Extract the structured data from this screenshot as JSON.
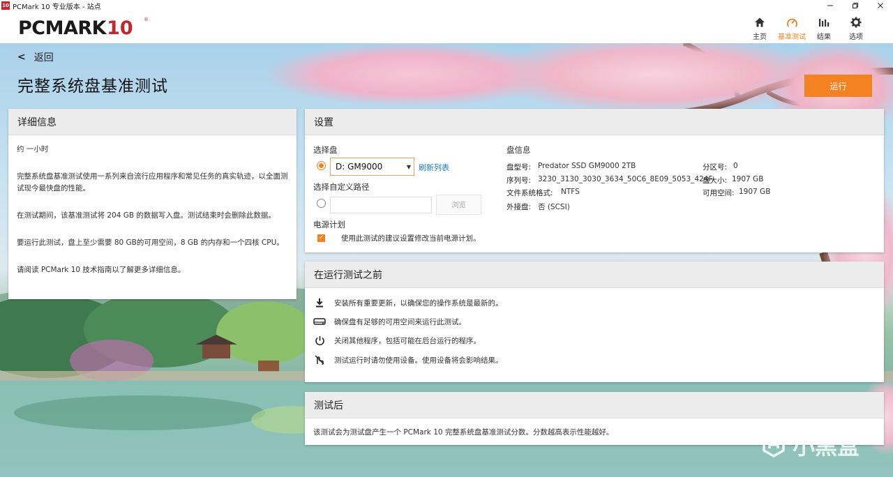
{
  "window": {
    "title": "PCMark 10 专业版本 - 站点",
    "icon_text": "10"
  },
  "header": {
    "logo_main": "PCMARK",
    "logo_num": "10",
    "logo_reg": "®",
    "nav": [
      {
        "label": "主页",
        "icon": "home-icon"
      },
      {
        "label": "基准测试",
        "icon": "gauge-icon",
        "active": true
      },
      {
        "label": "结果",
        "icon": "bar-chart-icon"
      },
      {
        "label": "选项",
        "icon": "gear-icon"
      }
    ]
  },
  "page": {
    "back_label": "返回",
    "title": "完整系统盘基准测试",
    "run_label": "运行"
  },
  "details": {
    "header": "详细信息",
    "paragraphs": [
      "约 一小时",
      "完整系统盘基准测试使用一系列来自流行应用程序和常见任务的真实轨迹，以全面测试现今最快盘的性能。",
      "在测试期间，该基准测试将 204 GB 的数据写入盘。测试结束时会删除此数据。",
      "要运行此测试，盘上至少需要 80 GB的可用空间，8 GB 的内存和一个四核 CPU。",
      "请阅读 PCMark 10 技术指南以了解更多详细信息。"
    ]
  },
  "settings": {
    "header": "设置",
    "select_drive_label": "选择盘",
    "selected_drive": "D: GM9000",
    "refresh_label": "刷新列表",
    "custom_path_label": "选择自定义路径",
    "path_value": "",
    "browse_label": "浏览",
    "power_label": "电源计划",
    "power_check_label": "使用此测试的建议设置修改当前电源计划。",
    "drive_info": {
      "title": "盘信息",
      "model_k": "盘型号:",
      "model_v": "Predator SSD GM9000 2TB",
      "serial_k": "序列号:",
      "serial_v": "3230_3130_3030_3634_50C6_8E09_5053_424F.",
      "fs_k": "文件系统格式:",
      "fs_v": "NTFS",
      "ext_k": "外接盘:",
      "ext_v": "否 (SCSI)",
      "part_k": "分区号:",
      "part_v": "0",
      "size_k": "盘大小:",
      "size_v": "1907 GB",
      "free_k": "可用空间:",
      "free_v": "1907 GB"
    }
  },
  "before": {
    "header": "在运行测试之前",
    "items": [
      {
        "icon": "download-icon",
        "text": "安装所有重要更新，以确保您的操作系统是最新的。"
      },
      {
        "icon": "drive-icon",
        "text": "确保盘有足够的可用空间来运行此测试。"
      },
      {
        "icon": "power-icon",
        "text": "关闭其他程序，包括可能在后台运行的程序。"
      },
      {
        "icon": "no-touch-icon",
        "text": "测试运行时请勿使用设备。使用设备将会影响结果。"
      }
    ]
  },
  "after": {
    "header": "测试后",
    "text": "该测试会为测试盘产生一个 PCMark 10 完整系统盘基准测试分数。分数越高表示性能越好。"
  },
  "watermark": {
    "text": "小黑盒"
  },
  "colors": {
    "accent": "#f58220",
    "brand_red": "#c1272d",
    "link": "#1a7bbf"
  }
}
